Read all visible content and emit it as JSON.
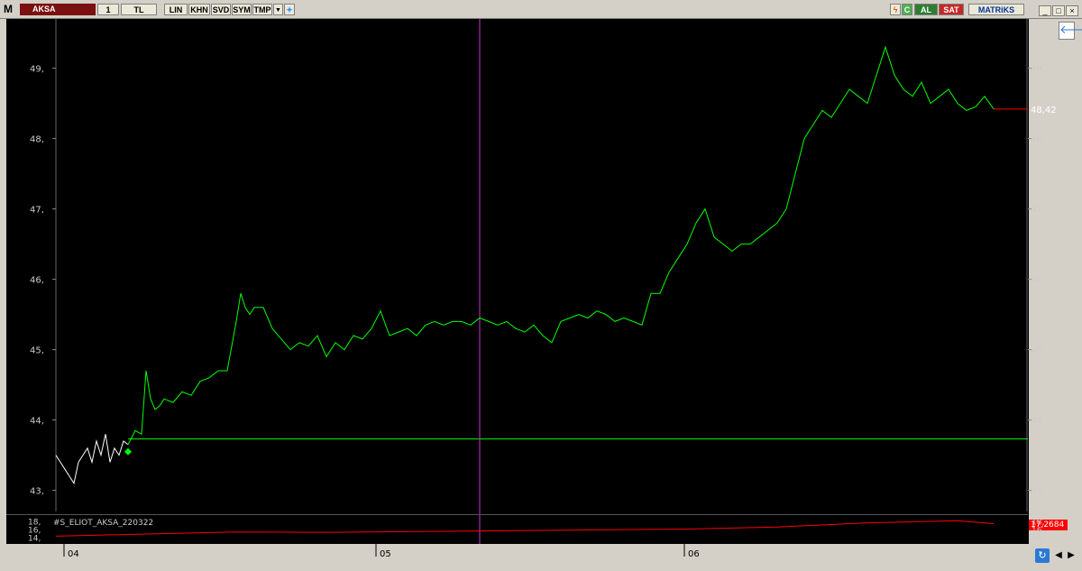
{
  "toolbar": {
    "logo": "M",
    "symbol": "AKSA",
    "interval": "1",
    "currency": "TL",
    "buttons": [
      "LIN",
      "KHN",
      "SVD",
      "SYM",
      "TMP"
    ],
    "c_label": "C",
    "buy_label": "AL",
    "sell_label": "SAT",
    "brand": "MATRiKS"
  },
  "chart_data": {
    "type": "line",
    "ylim": [
      42.7,
      49.7
    ],
    "y_ticks": [
      "43,",
      "44,",
      "45,",
      "46,",
      "47,",
      "48,",
      "49,"
    ],
    "y_tick_values": [
      43,
      44,
      45,
      46,
      47,
      48,
      49
    ],
    "last_price_label": "48,42",
    "last_price": 48.42,
    "support_level": 43.73,
    "x_ticks": [
      "04",
      "05",
      "06"
    ],
    "series": [
      {
        "color": "#ffffff",
        "x": [
          0,
          5,
          10,
          15,
          20,
          25,
          30,
          35,
          40,
          45,
          50,
          55,
          60,
          65,
          70,
          75,
          80
        ],
        "y": [
          43.5,
          43.4,
          43.3,
          43.2,
          43.1,
          43.4,
          43.5,
          43.6,
          43.4,
          43.7,
          43.5,
          43.8,
          43.4,
          43.6,
          43.5,
          43.7,
          43.65
        ]
      },
      {
        "color": "#00ff00",
        "x": [
          80,
          88,
          95,
          100,
          105,
          110,
          115,
          120,
          130,
          140,
          150,
          160,
          170,
          180,
          190,
          200,
          205,
          210,
          215,
          220,
          230,
          240,
          250,
          260,
          270,
          280,
          290,
          300,
          310,
          320,
          330,
          340,
          350,
          360,
          370,
          380,
          390,
          400,
          410,
          420,
          430,
          440,
          450,
          460,
          470,
          480,
          490,
          500,
          510,
          520,
          530,
          540,
          550,
          560,
          570,
          580,
          590,
          600,
          610,
          620,
          630,
          640,
          650,
          660,
          670,
          680,
          690,
          700,
          710,
          720,
          730,
          740,
          750,
          760,
          770,
          780,
          790,
          800,
          810,
          820,
          830,
          840,
          850,
          860,
          870,
          880,
          890,
          900,
          910,
          920,
          930,
          940,
          950,
          960,
          970,
          980,
          990,
          1000,
          1010,
          1020,
          1030,
          1040
        ],
        "y": [
          43.65,
          43.85,
          43.8,
          44.7,
          44.3,
          44.15,
          44.2,
          44.3,
          44.25,
          44.4,
          44.35,
          44.55,
          44.6,
          44.7,
          44.7,
          45.4,
          45.8,
          45.6,
          45.5,
          45.6,
          45.6,
          45.3,
          45.15,
          45.0,
          45.1,
          45.05,
          45.2,
          44.9,
          45.1,
          45.0,
          45.2,
          45.15,
          45.3,
          45.55,
          45.2,
          45.25,
          45.3,
          45.2,
          45.35,
          45.4,
          45.35,
          45.4,
          45.4,
          45.35,
          45.45,
          45.4,
          45.35,
          45.4,
          45.3,
          45.25,
          45.35,
          45.2,
          45.1,
          45.4,
          45.45,
          45.5,
          45.45,
          45.55,
          45.5,
          45.4,
          45.45,
          45.4,
          45.35,
          45.8,
          45.8,
          46.1,
          46.3,
          46.5,
          46.8,
          47.0,
          46.6,
          46.5,
          46.4,
          46.5,
          46.5,
          46.6,
          46.7,
          46.8,
          47.0,
          47.5,
          48.0,
          48.2,
          48.4,
          48.3,
          48.5,
          48.7,
          48.6,
          48.5,
          48.9,
          49.3,
          48.9,
          48.7,
          48.6,
          48.8,
          48.5,
          48.6,
          48.7,
          48.5,
          48.4,
          48.45,
          48.6,
          48.42
        ]
      }
    ],
    "indicator": {
      "name": "#S_ELIOT_AKSA_220322",
      "y_ticks": [
        "18,",
        "16,",
        "14,"
      ],
      "value_label": "17,2684",
      "color": "#ff0000",
      "x": [
        0,
        100,
        200,
        300,
        400,
        500,
        600,
        700,
        800,
        900,
        1000,
        1040
      ],
      "y": [
        14.3,
        14.8,
        15.3,
        15.2,
        15.4,
        15.6,
        15.8,
        16.0,
        16.5,
        17.5,
        18.0,
        17.3
      ]
    }
  },
  "colors": {
    "background": "#000000",
    "price_up": "#00ff00",
    "price_pre": "#ffffff",
    "crosshair": "#cc33cc",
    "indicator": "#ff0000",
    "symbol_bg": "#7a1010"
  }
}
